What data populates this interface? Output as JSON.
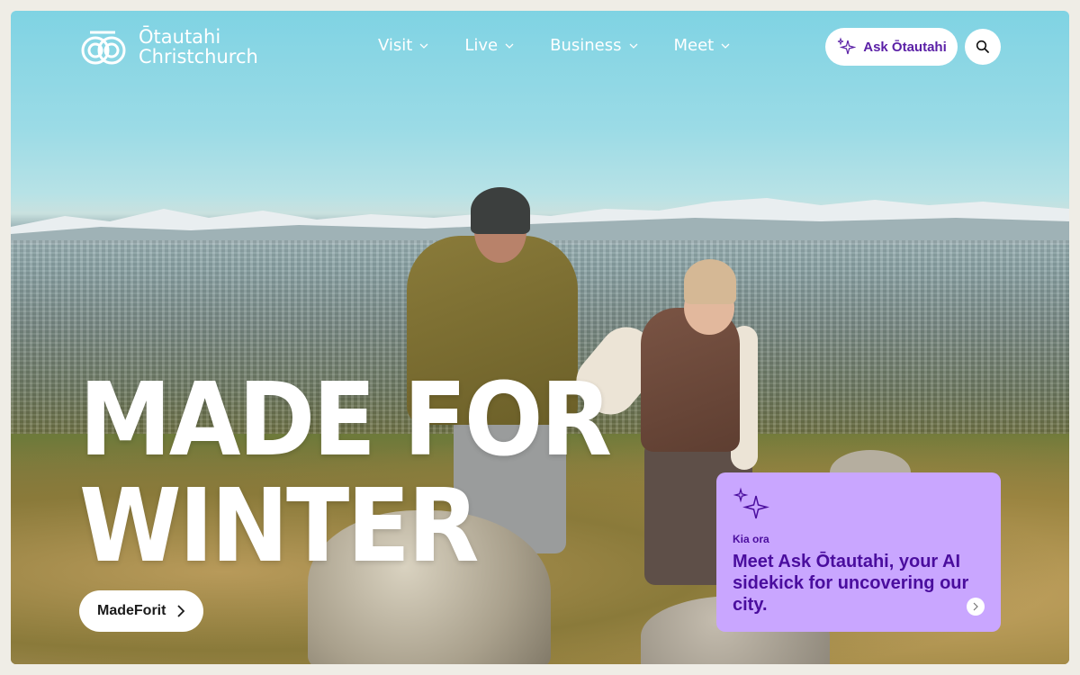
{
  "brand": {
    "line1": "Ōtautahi",
    "line2": "Christchurch"
  },
  "nav": {
    "items": [
      {
        "label": "Visit"
      },
      {
        "label": "Live"
      },
      {
        "label": "Business"
      },
      {
        "label": "Meet"
      }
    ]
  },
  "header": {
    "ask_label": "Ask Ōtautahi",
    "search_icon": "search-icon"
  },
  "hero": {
    "headline_line1": "MADE FOR",
    "headline_line2": "WINTER",
    "cta_label": "MadeForit"
  },
  "promo": {
    "kicker": "Kia ora",
    "text": "Meet Ask Ōtautahi, your AI sidekick for uncovering our city."
  },
  "colors": {
    "accent_purple": "#5a1fa6",
    "card_bg": "#c9a6ff",
    "page_bg": "#efede6"
  }
}
